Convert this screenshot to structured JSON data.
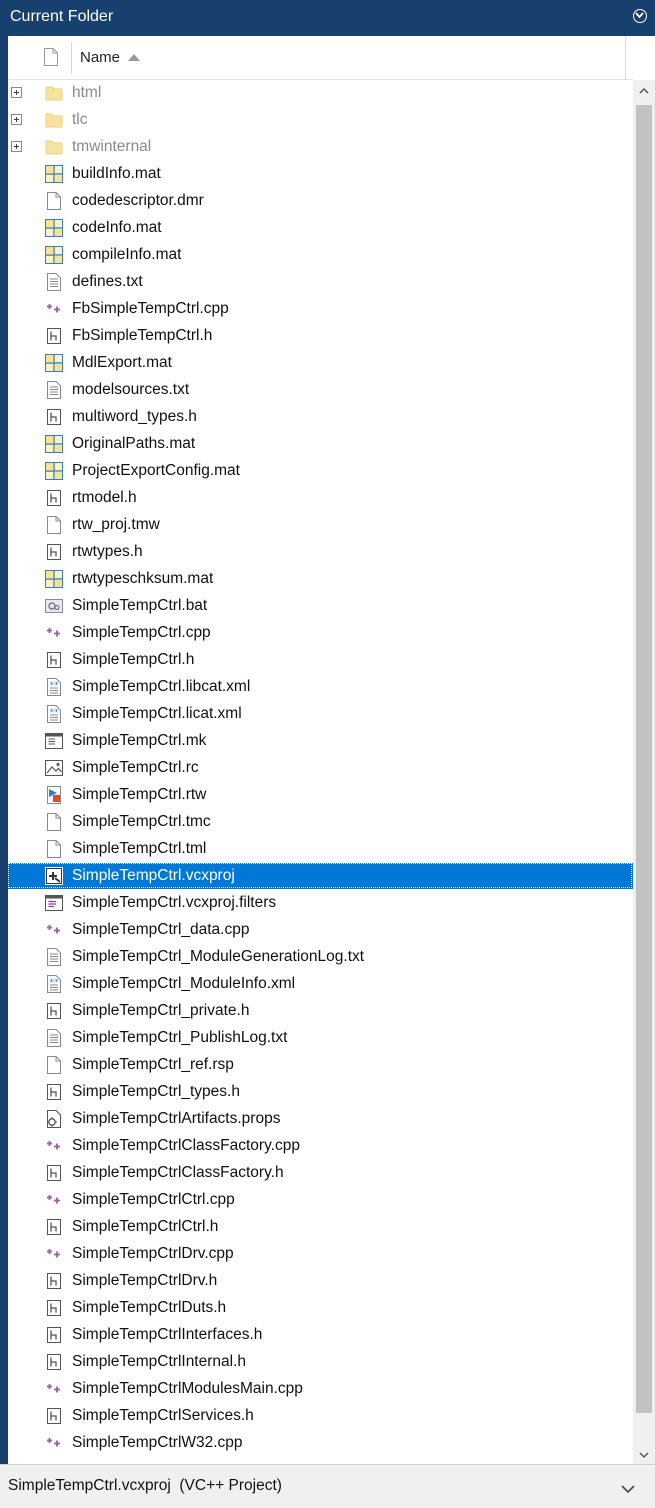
{
  "panel": {
    "title": "Current Folder",
    "menu_icon": "circle-chevron-down-icon"
  },
  "header": {
    "name_label": "Name",
    "sort": "ascending"
  },
  "colors": {
    "frame": "#18406f",
    "selection": "#0078d7",
    "scrollbar_thumb": "#c2c2c2"
  },
  "files": [
    {
      "name": "html",
      "icon": "folder",
      "expandable": true
    },
    {
      "name": "tlc",
      "icon": "folder",
      "expandable": true
    },
    {
      "name": "tmwinternal",
      "icon": "folder",
      "expandable": true
    },
    {
      "name": "buildInfo.mat",
      "icon": "mat"
    },
    {
      "name": "codedescriptor.dmr",
      "icon": "blank"
    },
    {
      "name": "codeInfo.mat",
      "icon": "mat"
    },
    {
      "name": "compileInfo.mat",
      "icon": "mat"
    },
    {
      "name": "defines.txt",
      "icon": "txt"
    },
    {
      "name": "FbSimpleTempCtrl.cpp",
      "icon": "cpp"
    },
    {
      "name": "FbSimpleTempCtrl.h",
      "icon": "h"
    },
    {
      "name": "MdlExport.mat",
      "icon": "mat"
    },
    {
      "name": "modelsources.txt",
      "icon": "txt"
    },
    {
      "name": "multiword_types.h",
      "icon": "h"
    },
    {
      "name": "OriginalPaths.mat",
      "icon": "mat"
    },
    {
      "name": "ProjectExportConfig.mat",
      "icon": "mat"
    },
    {
      "name": "rtmodel.h",
      "icon": "h"
    },
    {
      "name": "rtw_proj.tmw",
      "icon": "blank"
    },
    {
      "name": "rtwtypes.h",
      "icon": "h"
    },
    {
      "name": "rtwtypeschksum.mat",
      "icon": "mat"
    },
    {
      "name": "SimpleTempCtrl.bat",
      "icon": "bat"
    },
    {
      "name": "SimpleTempCtrl.cpp",
      "icon": "cpp"
    },
    {
      "name": "SimpleTempCtrl.h",
      "icon": "h"
    },
    {
      "name": "SimpleTempCtrl.libcat.xml",
      "icon": "xml"
    },
    {
      "name": "SimpleTempCtrl.licat.xml",
      "icon": "xml"
    },
    {
      "name": "SimpleTempCtrl.mk",
      "icon": "mk"
    },
    {
      "name": "SimpleTempCtrl.rc",
      "icon": "rc"
    },
    {
      "name": "SimpleTempCtrl.rtw",
      "icon": "rtw"
    },
    {
      "name": "SimpleTempCtrl.tmc",
      "icon": "blank"
    },
    {
      "name": "SimpleTempCtrl.tml",
      "icon": "blank"
    },
    {
      "name": "SimpleTempCtrl.vcxproj",
      "icon": "vcxproj",
      "selected": true
    },
    {
      "name": "SimpleTempCtrl.vcxproj.filters",
      "icon": "filters"
    },
    {
      "name": "SimpleTempCtrl_data.cpp",
      "icon": "cpp"
    },
    {
      "name": "SimpleTempCtrl_ModuleGenerationLog.txt",
      "icon": "txt"
    },
    {
      "name": "SimpleTempCtrl_ModuleInfo.xml",
      "icon": "xml"
    },
    {
      "name": "SimpleTempCtrl_private.h",
      "icon": "h"
    },
    {
      "name": "SimpleTempCtrl_PublishLog.txt",
      "icon": "txt"
    },
    {
      "name": "SimpleTempCtrl_ref.rsp",
      "icon": "blank"
    },
    {
      "name": "SimpleTempCtrl_types.h",
      "icon": "h"
    },
    {
      "name": "SimpleTempCtrlArtifacts.props",
      "icon": "props"
    },
    {
      "name": "SimpleTempCtrlClassFactory.cpp",
      "icon": "cpp"
    },
    {
      "name": "SimpleTempCtrlClassFactory.h",
      "icon": "h"
    },
    {
      "name": "SimpleTempCtrlCtrl.cpp",
      "icon": "cpp"
    },
    {
      "name": "SimpleTempCtrlCtrl.h",
      "icon": "h"
    },
    {
      "name": "SimpleTempCtrlDrv.cpp",
      "icon": "cpp"
    },
    {
      "name": "SimpleTempCtrlDrv.h",
      "icon": "h"
    },
    {
      "name": "SimpleTempCtrlDuts.h",
      "icon": "h"
    },
    {
      "name": "SimpleTempCtrlInterfaces.h",
      "icon": "h"
    },
    {
      "name": "SimpleTempCtrlInternal.h",
      "icon": "h"
    },
    {
      "name": "SimpleTempCtrlModulesMain.cpp",
      "icon": "cpp"
    },
    {
      "name": "SimpleTempCtrlServices.h",
      "icon": "h"
    },
    {
      "name": "SimpleTempCtrlW32.cpp",
      "icon": "cpp"
    }
  ],
  "status": {
    "text": "SimpleTempCtrl.vcxproj  (VC++ Project)",
    "expand_icon": "chevron-down-icon"
  }
}
